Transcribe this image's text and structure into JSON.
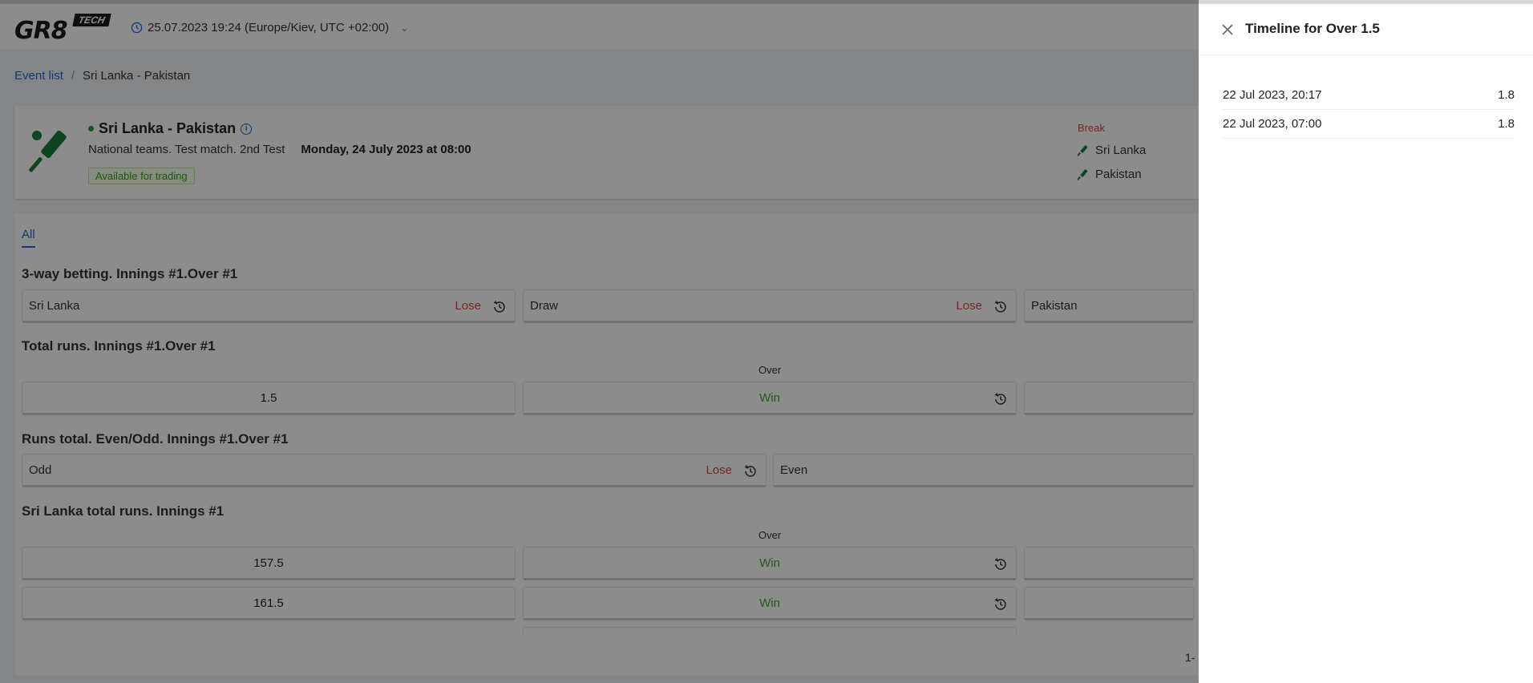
{
  "header": {
    "logo_text": "GR8",
    "logo_badge": "TECH",
    "datetime": "25.07.2023 19:24 (Europe/Kiev, UTC +02:00)"
  },
  "breadcrumb": {
    "link": "Event list",
    "separator": "/",
    "current": "Sri Lanka - Pakistan"
  },
  "event": {
    "title": "Sri Lanka - Pakistan",
    "info_icon": "i",
    "competition": "National teams. Test match. 2nd Test",
    "start": "Monday, 24 July 2023 at 08:00",
    "badge": "Available for trading",
    "status": "Break",
    "team1": "Sri Lanka",
    "team2": "Pakistan"
  },
  "tabs": {
    "all": "All"
  },
  "markets": {
    "m1": {
      "title": "3-way betting. Innings #1.Over #1",
      "o1_label": "Sri Lanka",
      "o1_result": "Lose",
      "o2_label": "Draw",
      "o2_result": "Lose",
      "o3_label": "Pakistan"
    },
    "m2": {
      "title": "Total runs. Innings #1.Over #1",
      "col_over": "Over",
      "line": "1.5",
      "result": "Win"
    },
    "m3": {
      "title": "Runs total. Even/Odd. Innings #1.Over #1",
      "o1_label": "Odd",
      "o1_result": "Lose",
      "o2_label": "Even"
    },
    "m4": {
      "title": "Sri Lanka total runs. Innings #1",
      "col_over": "Over",
      "r1_line": "157.5",
      "r1_result": "Win",
      "r2_line": "161.5",
      "r2_result": "Win"
    }
  },
  "pager_text": "1-",
  "drawer": {
    "title": "Timeline for Over 1.5",
    "rows": [
      {
        "time": "22 Jul 2023, 20:17",
        "value": "1.8"
      },
      {
        "time": "22 Jul 2023, 07:00",
        "value": "1.8"
      }
    ]
  },
  "colors": {
    "accent": "#1f6ad6",
    "lose": "#e04040",
    "win": "#3fa82a",
    "sport_icon": "#1e7a3c"
  },
  "icons": [
    "clock-icon",
    "chevron-down-icon",
    "cricket-bat-icon",
    "info-icon",
    "history-icon",
    "close-icon"
  ]
}
